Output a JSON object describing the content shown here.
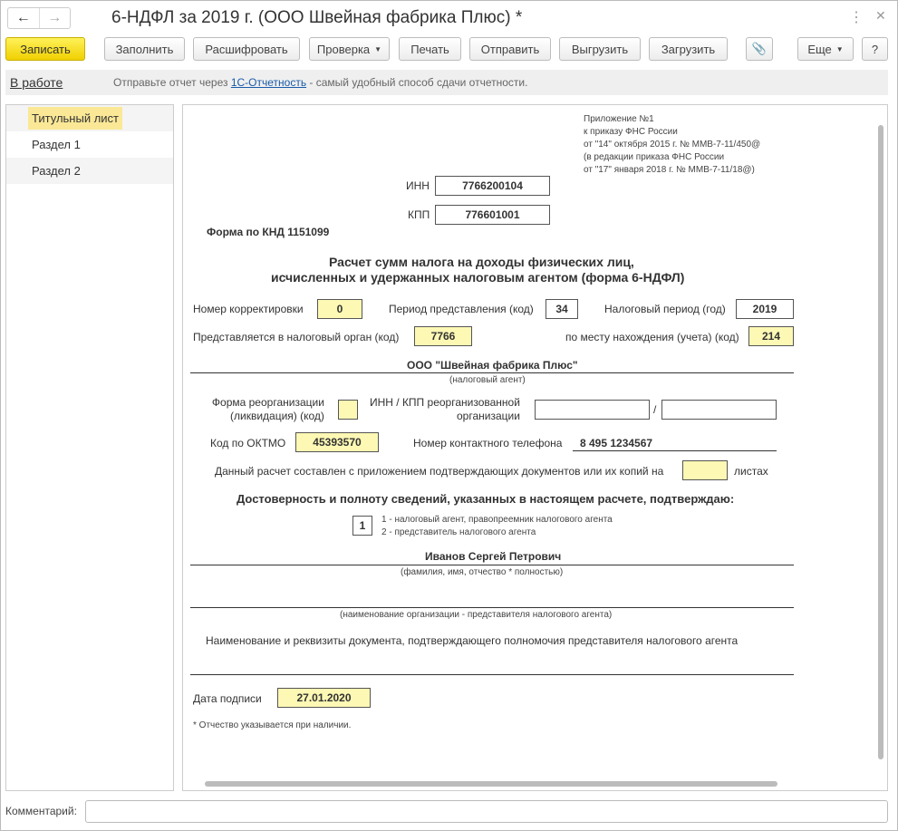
{
  "window": {
    "title": "6-НДФЛ за 2019 г. (ООО Швейная фабрика Плюс) *",
    "back_icon": "arrow-left",
    "forward_icon": "arrow-right",
    "more_icon": "kebab",
    "close_icon": "x"
  },
  "toolbar": {
    "save": "Записать",
    "fill": "Заполнить",
    "decode": "Расшифровать",
    "check": "Проверка",
    "print": "Печать",
    "send": "Отправить",
    "export": "Выгрузить",
    "import": "Загрузить",
    "more": "Еще",
    "help": "?",
    "attach_icon": "paperclip"
  },
  "status": {
    "state": "В работе",
    "hint_before": "Отправьте отчет через ",
    "hint_link": "1С-Отчетность",
    "hint_after": " - самый удобный способ сдачи отчетности."
  },
  "sidebar": {
    "items": [
      {
        "label": "Титульный лист",
        "selected": true
      },
      {
        "label": "Раздел 1"
      },
      {
        "label": "Раздел 2"
      }
    ]
  },
  "form": {
    "appendix": [
      "Приложение №1",
      "к приказу ФНС России",
      "от \"14\" октября 2015 г. № ММВ-7-11/450@",
      "(в редакции приказа ФНС России",
      "от \"17\" января 2018 г. № ММВ-7-11/18@)"
    ],
    "inn_label": "ИНН",
    "inn": "7766200104",
    "kpp_label": "КПП",
    "kpp": "776601001",
    "knd": "Форма по КНД 1151099",
    "title1": "Расчет сумм налога на доходы физических лиц,",
    "title2": "исчисленных и удержанных налоговым агентом (форма 6-НДФЛ)",
    "corr_label": "Номер корректировки",
    "corr": "0",
    "period_label": "Период представления (код)",
    "period": "34",
    "year_label": "Налоговый период (год)",
    "year": "2019",
    "org_label": "Представляется в налоговый орган (код)",
    "org": "7766",
    "place_label": "по месту нахождения (учета) (код)",
    "place": "214",
    "agent": "ООО \"Швейная фабрика Плюс\"",
    "agent_caption": "(налоговый агент)",
    "reorg_label1": "Форма реорганизации",
    "reorg_label2": "(ликвидация) (код)",
    "reorg": "",
    "reorg_inn_label1": "ИНН / КПП реорганизованной",
    "reorg_inn_label2": "организации",
    "reorg_inn": "",
    "reorg_kpp": "",
    "slash": "/",
    "oktmo_label": "Код по ОКТМО",
    "oktmo": "45393570",
    "phone_label": "Номер контактного телефона",
    "phone": "8 495 1234567",
    "attach_label": "Данный расчет составлен с приложением подтверждающих документов или их копий на",
    "attach": "",
    "sheets": "листах",
    "confirm": "Достоверность и полноту сведений, указанных в настоящем расчете, подтверждаю:",
    "signer_code": "1",
    "signer_opt1": "1 - налоговый агент, правопреемник налогового агента",
    "signer_opt2": "2 - представитель налогового агента",
    "fio": "Иванов Сергей Петрович",
    "fio_caption": "(фамилия, имя, отчество * полностью)",
    "rep_caption": "(наименование организации - представителя налогового агента)",
    "doc_label": "Наименование и реквизиты документа, подтверждающего полномочия представителя налогового агента",
    "date_label": "Дата подписи",
    "date": "27.01.2020",
    "footnote": "* Отчество указывается при наличии."
  },
  "comment": {
    "label": "Комментарий:",
    "value": ""
  }
}
